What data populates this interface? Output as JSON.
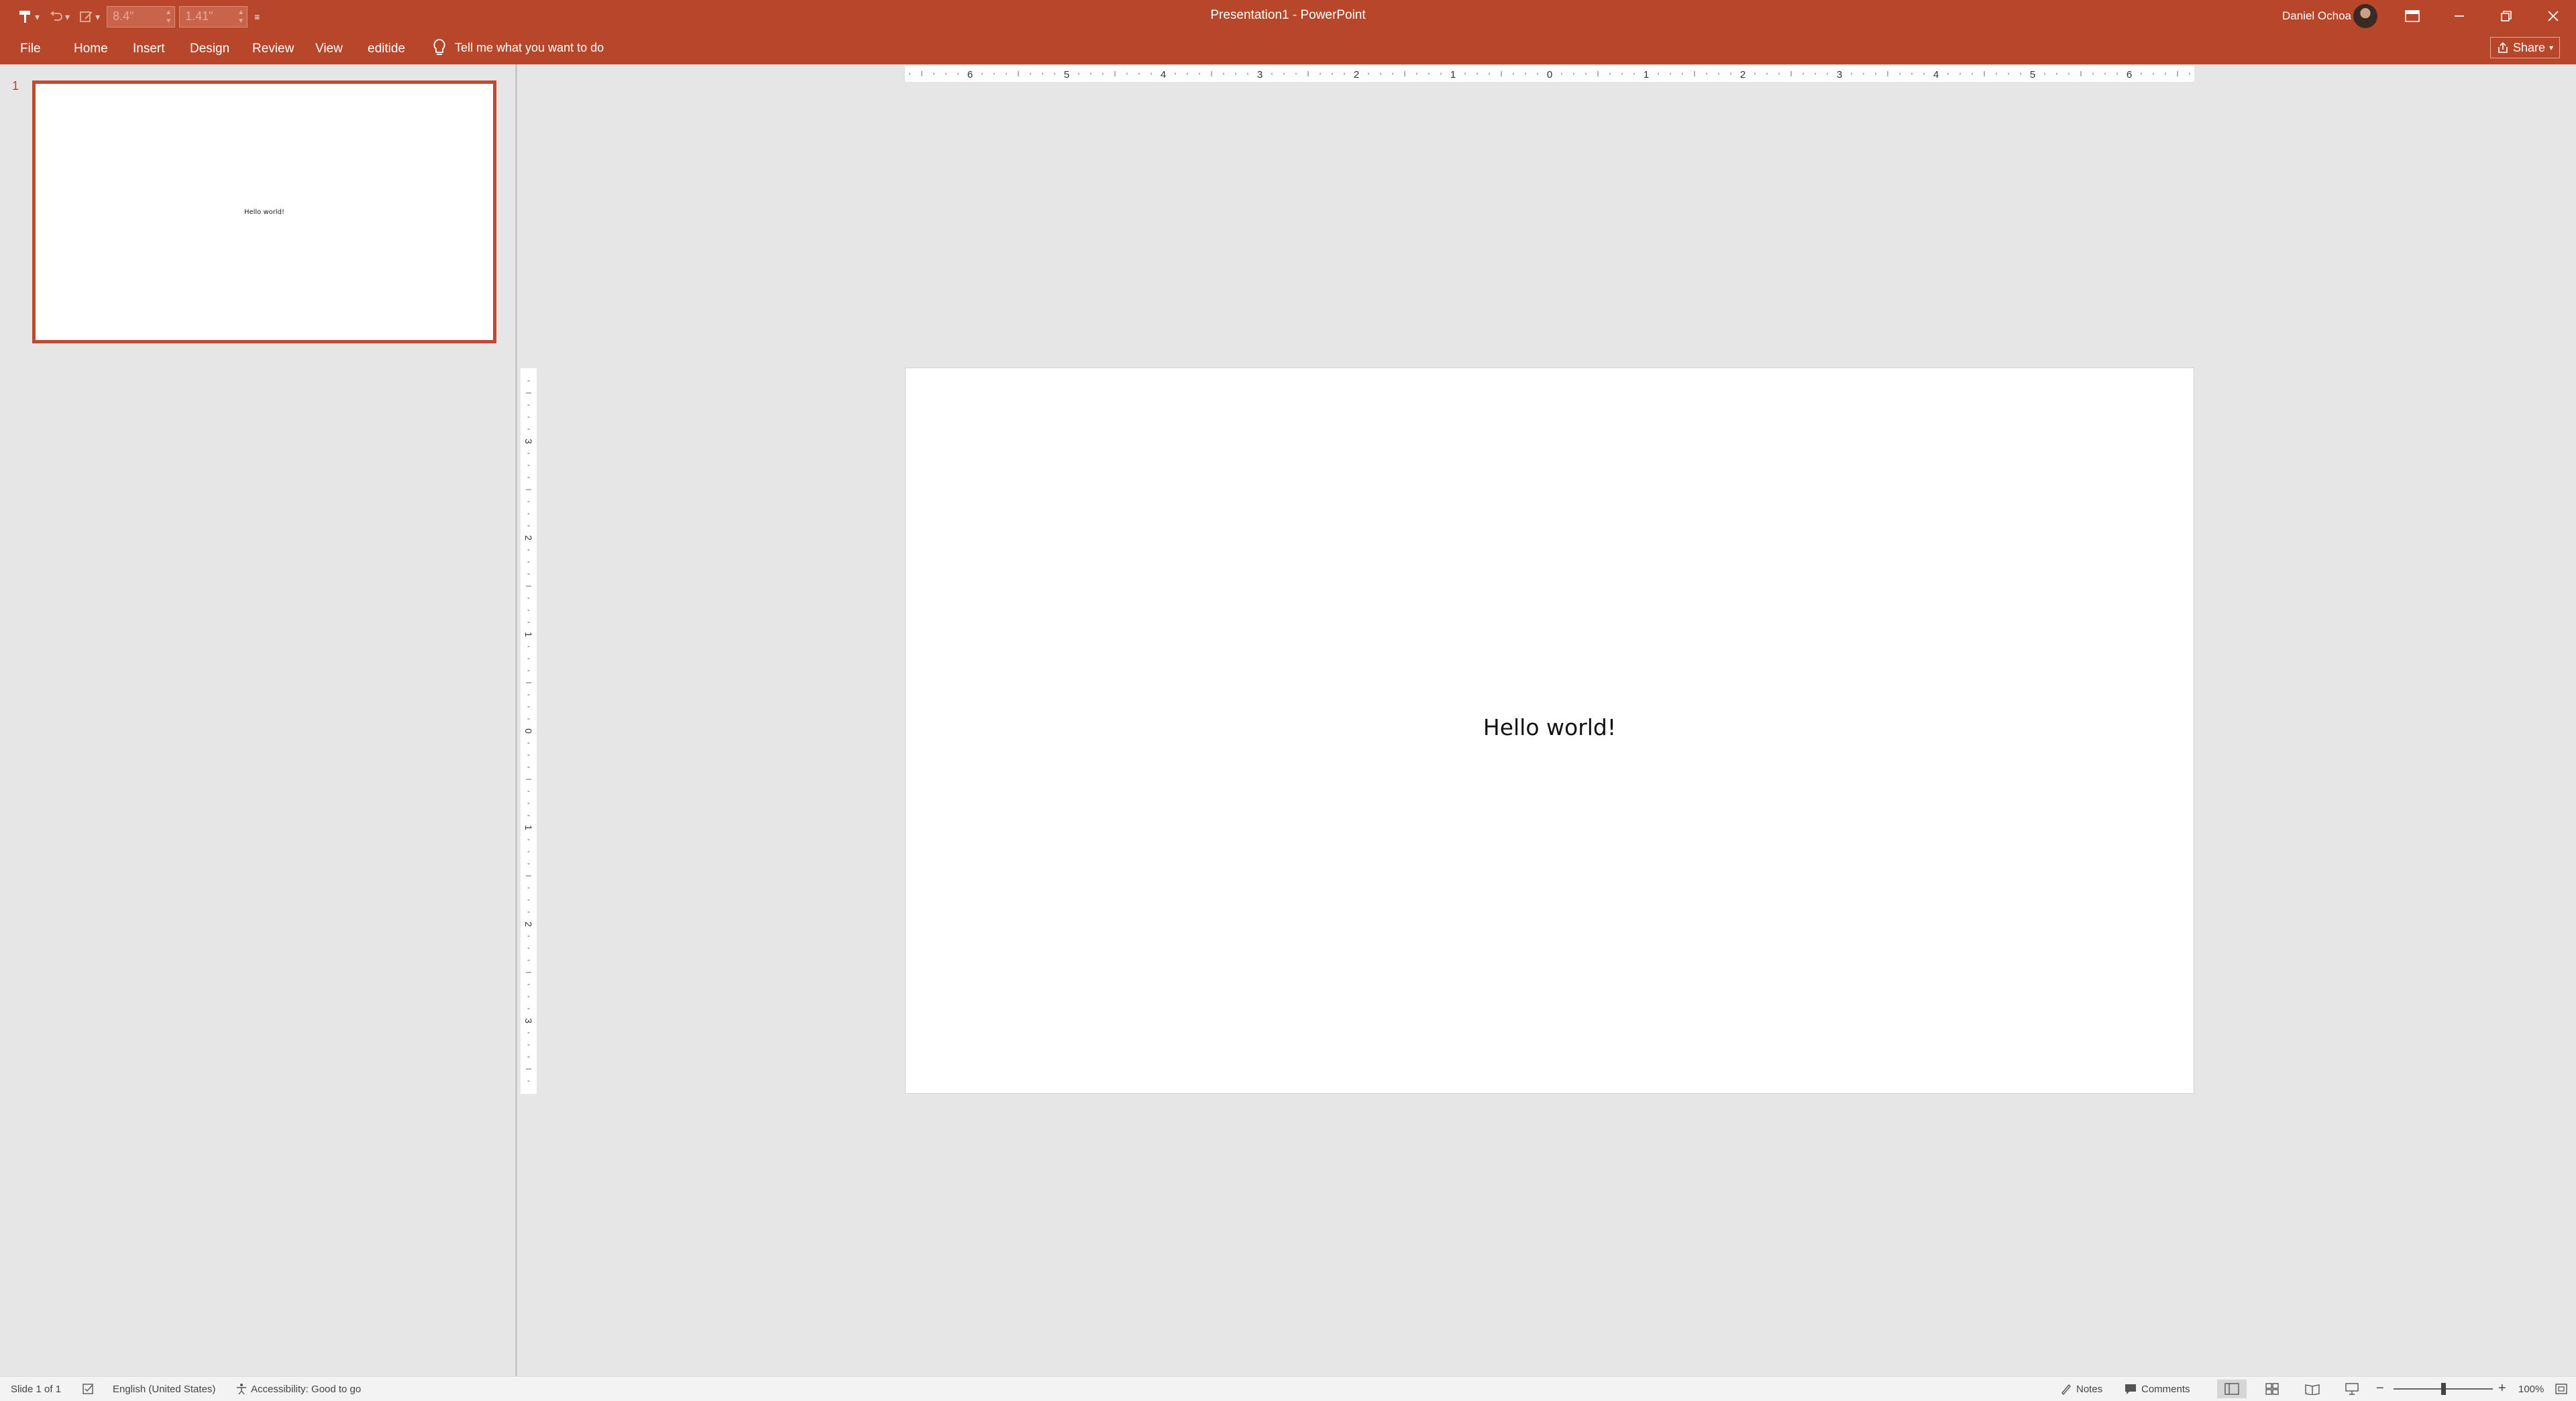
{
  "titlebar": {
    "title": "Presentation1  -  PowerPoint",
    "user_name": "Daniel Ochoa",
    "qat_width_value": "8.4\"",
    "qat_height_value": "1.41\""
  },
  "tabs": [
    {
      "label": "File"
    },
    {
      "label": "Home"
    },
    {
      "label": "Insert"
    },
    {
      "label": "Design"
    },
    {
      "label": "Review"
    },
    {
      "label": "View"
    },
    {
      "label": "editide"
    }
  ],
  "tell_me": "Tell me what you want to do",
  "share_label": "Share",
  "thumbnails": [
    {
      "number": "1",
      "text": "Hello world!"
    }
  ],
  "slide": {
    "text": "Hello world!"
  },
  "hruler_labels": [
    "6",
    "5",
    "4",
    "3",
    "2",
    "1",
    "0",
    "1",
    "2",
    "3",
    "4",
    "5",
    "6"
  ],
  "vruler_labels": [
    "3",
    "2",
    "1",
    "0",
    "1",
    "2",
    "3"
  ],
  "statusbar": {
    "slide_info": "Slide 1 of 1",
    "language": "English (United States)",
    "accessibility": "Accessibility: Good to go",
    "notes": "Notes",
    "comments": "Comments",
    "zoom": "100%",
    "zoom_level_fraction": 0.5
  },
  "colors": {
    "accent": "#b7472a",
    "workspace": "#e6e6e6",
    "thumb_border": "#c0492f"
  }
}
